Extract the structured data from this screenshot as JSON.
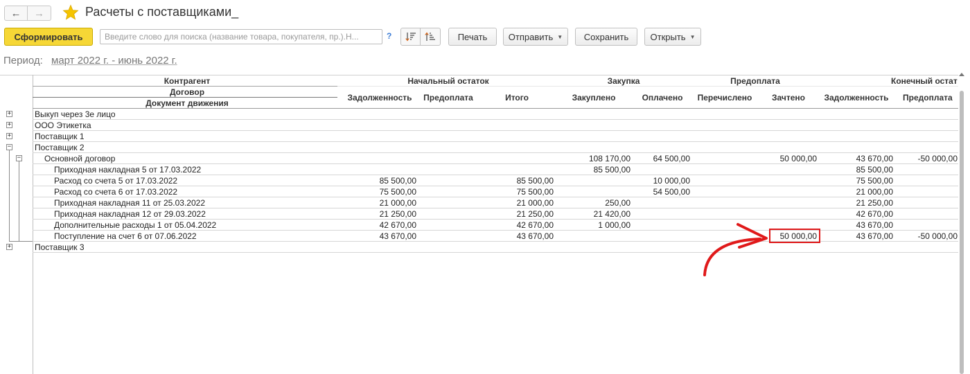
{
  "window": {
    "title": "Расчеты с поставщиками_",
    "back_icon": "arrow-left-icon",
    "forward_icon": "arrow-right-icon",
    "favorite_icon": "star-icon",
    "favorite_color": "#f5c400"
  },
  "toolbar": {
    "generate_label": "Сформировать",
    "generate_color": "#f6d736",
    "search_placeholder": "Введите слово для поиска (название товара, покупателя, пр.).Н...",
    "search_value": "",
    "help_label": "?",
    "print_label": "Печать",
    "send_label": "Отправить",
    "save_label": "Сохранить",
    "open_label": "Открыть"
  },
  "period": {
    "label": "Период:",
    "value": "март 2022 г. - июнь 2022 г."
  },
  "report": {
    "headers": {
      "counterparty": "Контрагент",
      "contract": "Договор",
      "document": "Документ движения",
      "opening_balance": "Начальный остаток",
      "purchase": "Закупка",
      "prepayment": "Предоплата",
      "closing_balance": "Конечный остат",
      "debt": "Задолженность",
      "prepaid": "Предоплата",
      "total": "Итого",
      "purchased": "Закуплено",
      "paid": "Оплачено",
      "transferred": "Перечислено",
      "offset": "Зачтено",
      "closing_debt": "Задолженность",
      "closing_prepaid": "Предоплата"
    },
    "rows": [
      {
        "level": 0,
        "toggle": "+",
        "label": "Выкуп через 3е лицо"
      },
      {
        "level": 0,
        "toggle": "+",
        "label": "ООО Этикетка"
      },
      {
        "level": 0,
        "toggle": "+",
        "label": "Поставщик 1"
      },
      {
        "level": 0,
        "toggle": "−",
        "label": "Поставщик 2"
      },
      {
        "level": 1,
        "toggle": "−",
        "label": "Основной договор",
        "purchased": "108 170,00",
        "paid": "64 500,00",
        "offset": "50 000,00",
        "closing_debt": "43 670,00",
        "closing_prepaid": "-50 000,00"
      },
      {
        "level": 2,
        "label": "Приходная накладная 5  от 17.03.2022",
        "purchased": "85 500,00",
        "closing_debt": "85 500,00"
      },
      {
        "level": 2,
        "label": "Расход со счета 5  от 17.03.2022",
        "debt": "85 500,00",
        "total": "85 500,00",
        "paid": "10 000,00",
        "closing_debt": "75 500,00"
      },
      {
        "level": 2,
        "label": "Расход со счета 6  от 17.03.2022",
        "debt": "75 500,00",
        "total": "75 500,00",
        "paid": "54 500,00",
        "closing_debt": "21 000,00"
      },
      {
        "level": 2,
        "label": "Приходная накладная 11  от 25.03.2022",
        "debt": "21 000,00",
        "total": "21 000,00",
        "purchased": "250,00",
        "closing_debt": "21 250,00"
      },
      {
        "level": 2,
        "label": "Приходная накладная 12  от 29.03.2022",
        "debt": "21 250,00",
        "total": "21 250,00",
        "purchased": "21 420,00",
        "closing_debt": "42 670,00"
      },
      {
        "level": 2,
        "label": "Дополнительные расходы 1  от 05.04.2022",
        "debt": "42 670,00",
        "total": "42 670,00",
        "purchased": "1 000,00",
        "closing_debt": "43 670,00"
      },
      {
        "level": 2,
        "label": "Поступление на счет 6  от 07.06.2022",
        "debt": "43 670,00",
        "total": "43 670,00",
        "offset": "50 000,00",
        "closing_debt": "43 670,00",
        "closing_prepaid": "-50 000,00",
        "highlighted": true
      },
      {
        "level": 0,
        "toggle": "+",
        "label": "Поставщик 3"
      }
    ]
  },
  "annotation": {
    "color": "#e0191a",
    "arrow_icon": "curved-arrow-icon"
  }
}
